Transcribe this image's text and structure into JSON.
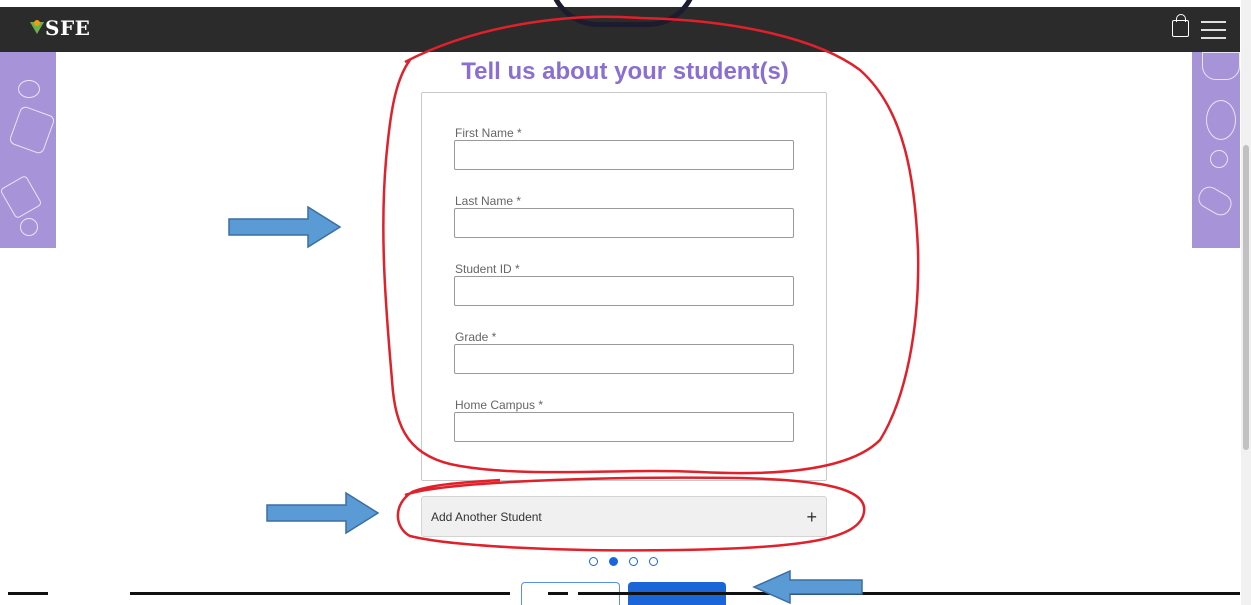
{
  "header": {
    "logo_text": "SFE",
    "icons": [
      "shopping-bag-icon",
      "hamburger-menu-icon"
    ]
  },
  "form": {
    "title": "Tell us about your student(s)",
    "fields": [
      {
        "label": "First Name *",
        "value": ""
      },
      {
        "label": "Last Name *",
        "value": ""
      },
      {
        "label": "Student ID *",
        "value": ""
      },
      {
        "label": "Grade *",
        "value": ""
      },
      {
        "label": "Home Campus *",
        "value": ""
      }
    ],
    "add_student_label": "Add Another Student",
    "add_student_icon": "+"
  },
  "pagination": {
    "total_steps": 4,
    "current_step": 2
  },
  "colors": {
    "header_bg": "#2b2b2b",
    "title": "#8a6fd1",
    "side_pattern": "#a793d8",
    "primary_button": "#1a66d8",
    "annotation_red": "#e0202a",
    "annotation_blue": "#5b9bd5"
  }
}
